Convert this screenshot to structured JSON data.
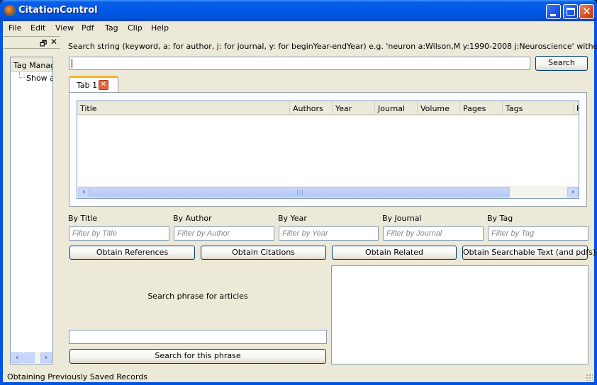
{
  "window": {
    "title": "CitationControl",
    "app_icon": "citation-control-logo",
    "controls": {
      "minimize": "minimize-icon",
      "maximize": "maximize-icon",
      "close": "close-icon"
    }
  },
  "menubar": [
    "File",
    "Edit",
    "View",
    "Pdf",
    "Tag",
    "Clip",
    "Help"
  ],
  "dock": {
    "float_glyph": "🗗",
    "close_glyph": "✕",
    "tree_header": "Tag Manager",
    "tree_items": [
      "Show all"
    ]
  },
  "search": {
    "hint": "Search string (keyword, a: for author, j: for journal, y: for beginYear-endYear) e.g. 'neuron a:Wilson,M y:1990-2008 j:Neuroscience' without the quotes.",
    "value": "",
    "button": "Search"
  },
  "tabs": [
    {
      "label": "Tab 1",
      "closable": true
    }
  ],
  "table": {
    "columns": [
      "Title",
      "Authors",
      "Year",
      "Journal",
      "Volume",
      "Pages",
      "Tags",
      "P"
    ],
    "rows": []
  },
  "filters": [
    {
      "label": "By Title",
      "placeholder": "Filter by Title",
      "value": ""
    },
    {
      "label": "By Author",
      "placeholder": "Filter by Author",
      "value": ""
    },
    {
      "label": "By Year",
      "placeholder": "Filter by Year",
      "value": ""
    },
    {
      "label": "By Journal",
      "placeholder": "Filter by Journal",
      "value": ""
    },
    {
      "label": "By Tag",
      "placeholder": "Filter by Tag",
      "value": ""
    }
  ],
  "actions": [
    "Obtain References",
    "Obtain Citations",
    "Obtain Related",
    "Obtain Searchable Text (and pdfs)"
  ],
  "phrase": {
    "label": "Search phrase for articles",
    "value": "",
    "button": "Search for this phrase"
  },
  "status": "Obtaining Previously Saved Records",
  "colors": {
    "titlebar": "#0058e6",
    "client_bg": "#ece9d8",
    "tab_highlight": "#f8b332",
    "tab_close": "#e4653a",
    "input_border": "#7f9db9"
  }
}
